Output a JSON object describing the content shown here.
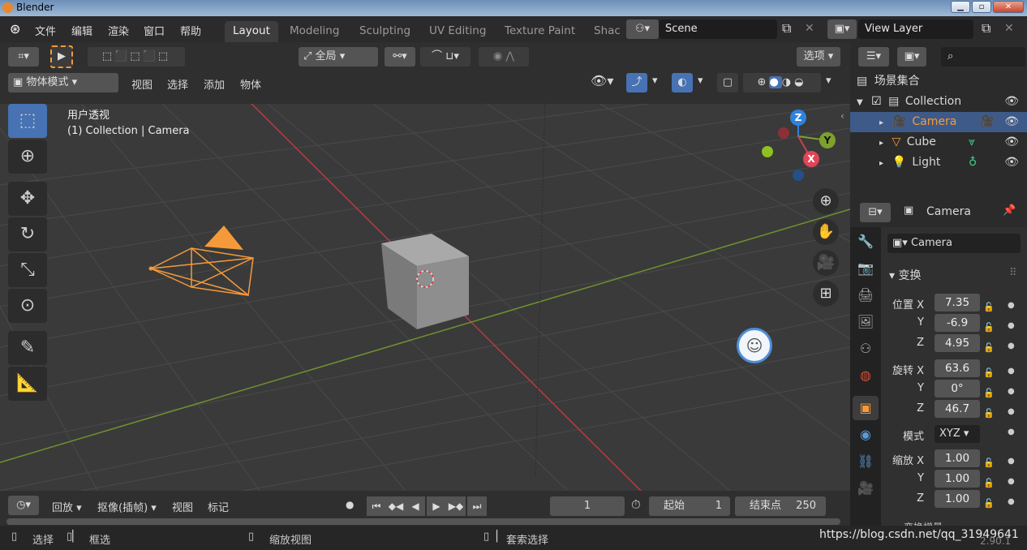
{
  "titlebar": {
    "title": "Blender"
  },
  "menus": [
    "文件",
    "编辑",
    "渲染",
    "窗口",
    "帮助"
  ],
  "workspaces": [
    "Layout",
    "Modeling",
    "Sculpting",
    "UV Editing",
    "Texture Paint",
    "Shac"
  ],
  "scene": {
    "name": "Scene"
  },
  "view_layer": {
    "name": "View Layer"
  },
  "header": {
    "pivot": "全局",
    "options_label": "选项",
    "mode": "物体模式",
    "view_menus": [
      "视图",
      "选择",
      "添加",
      "物体"
    ]
  },
  "viewport": {
    "view_name": "用户透视",
    "context": "(1) Collection | Camera"
  },
  "gizmo": {
    "z": "Z",
    "y": "Y",
    "x": "X"
  },
  "outliner": {
    "title": "场景集合",
    "items": [
      {
        "label": "Collection"
      },
      {
        "label": "Camera"
      },
      {
        "label": "Cube"
      },
      {
        "label": "Light"
      }
    ]
  },
  "properties": {
    "object_name": "Camera",
    "data_name": "Camera",
    "panel_title": "变换",
    "location_label": "位置 X",
    "location": [
      "7.35",
      "-6.9",
      "4.95"
    ],
    "rotation_label": "旋转 X",
    "rotation": [
      "63.6",
      "0°",
      "46.7"
    ],
    "mode_label": "模式",
    "rotation_mode": "XYZ",
    "scale_label": "缩放 X",
    "scale": [
      "1.00",
      "1.00",
      "1.00"
    ],
    "axis_y": "Y",
    "axis_z": "Z",
    "next_panel": "变换增量"
  },
  "timeline": {
    "playback": "回放",
    "keying": "抠像(插帧)",
    "view": "视图",
    "marker": "标记",
    "current_frame": "1",
    "start_label": "起始",
    "start": "1",
    "end_label": "结束点",
    "end": "250"
  },
  "status": {
    "select": "选择",
    "box_select": "框选",
    "zoom": "缩放视图",
    "lasso": "套索选择",
    "version": "2.90.1",
    "watermark": "https://blog.csdn.net/qq_31949641"
  },
  "colors": {
    "accent": "#4772b3",
    "selected": "#f59a3a",
    "x_axis": "#c8404f",
    "y_axis": "#7da22b",
    "z_axis": "#2f82e0"
  }
}
